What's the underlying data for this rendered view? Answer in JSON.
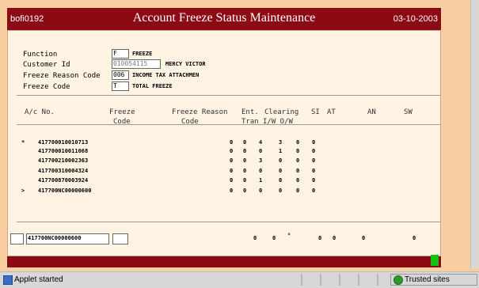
{
  "header": {
    "code": "bofi0192",
    "title": "Account Freeze Status Maintenance",
    "date": "03-10-2003"
  },
  "form": {
    "function": {
      "label": "Function",
      "value": "F",
      "desc": "FREEZE"
    },
    "customer_id": {
      "label": "Customer Id",
      "value": "010054115",
      "desc": "MERCY VICTOR"
    },
    "freeze_reason": {
      "label": "Freeze Reason Code",
      "value": "006",
      "desc": "INCOME TAX ATTACHMEN"
    },
    "freeze_code": {
      "label": "Freeze Code",
      "value": "T",
      "desc": "TOTAL FREEZE"
    }
  },
  "table": {
    "headers": {
      "acno": "A/c No.",
      "freeze_code_1": "Freeze",
      "freeze_code_2": "Code",
      "freeze_reason_1": "Freeze Reason",
      "freeze_reason_2": "Code",
      "ent_1": "Ent.",
      "ent_2": "Tran",
      "clearing_1": "Clearing",
      "clearing_2": "I/W  O/W",
      "si": "SI",
      "at": "AT",
      "an": "AN",
      "sw": "SW"
    },
    "rows": [
      {
        "marker": "*",
        "acno": "417700010010713",
        "ent": "0",
        "iw": "4",
        "ow": "3",
        "si": "0",
        "at": "0",
        "zero": "0"
      },
      {
        "marker": "",
        "acno": "417700010011068",
        "ent": "0",
        "iw": "0",
        "ow": "1",
        "si": "0",
        "at": "0",
        "zero": "0"
      },
      {
        "marker": "",
        "acno": "417700210002363",
        "ent": "0",
        "iw": "3",
        "ow": "0",
        "si": "0",
        "at": "0",
        "zero": "0"
      },
      {
        "marker": "",
        "acno": "417700310004324",
        "ent": "0",
        "iw": "0",
        "ow": "0",
        "si": "0",
        "at": "0",
        "zero": "0"
      },
      {
        "marker": "",
        "acno": "417700870003924",
        "ent": "0",
        "iw": "1",
        "ow": "0",
        "si": "0",
        "at": "0",
        "zero": "0"
      },
      {
        "marker": ">",
        "acno": "417700NC00000600",
        "ent": "0",
        "iw": "0",
        "ow": "0",
        "si": "0",
        "at": "0",
        "zero": "0"
      }
    ]
  },
  "bottom": {
    "acno": "417700NC00000600",
    "ent": "0",
    "iw": "0",
    "ow": "°",
    "si": "0",
    "at": "0",
    "an": "0",
    "sw": "0"
  },
  "status": {
    "text": "Applet started",
    "trusted": "Trusted sites"
  },
  "colors": {
    "accent": "#8b0a14",
    "background": "#f9cfa2",
    "panel": "#fff3e4"
  }
}
